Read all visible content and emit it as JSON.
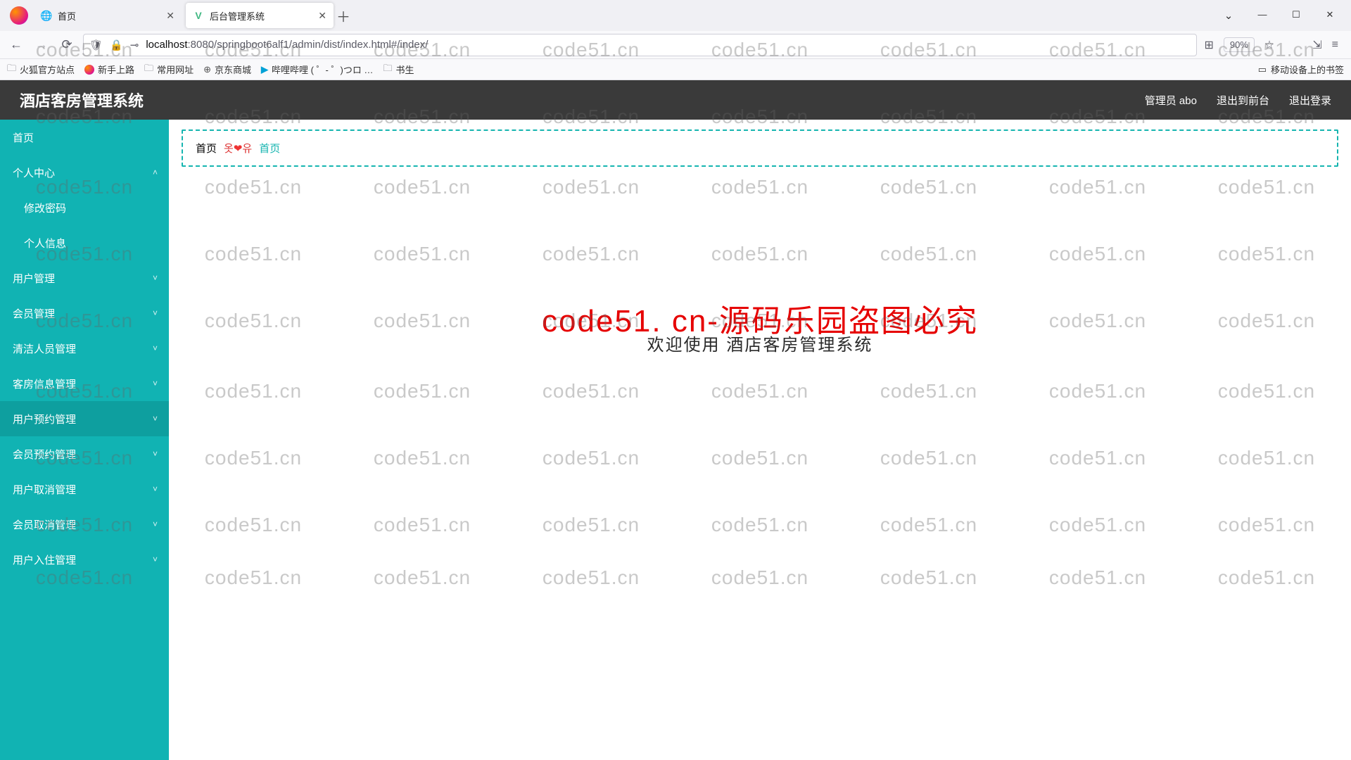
{
  "browser": {
    "tabs": [
      {
        "title": "首页",
        "active": false,
        "favicon": "globe"
      },
      {
        "title": "后台管理系统",
        "active": true,
        "favicon": "vue"
      }
    ],
    "url_host": "localhost",
    "url_rest": ":8080/springboot6alf1/admin/dist/index.html#/index/",
    "zoom": "90%",
    "bookmarks": [
      {
        "label": "火狐官方站点",
        "kind": "folder"
      },
      {
        "label": "新手上路",
        "kind": "firefox"
      },
      {
        "label": "常用网址",
        "kind": "folder"
      },
      {
        "label": "京东商城",
        "kind": "jd"
      },
      {
        "label": "哔哩哔哩 (  ゜- ゜)つロ …",
        "kind": "bili"
      },
      {
        "label": "书生",
        "kind": "folder"
      }
    ],
    "mobile_bookmarks_label": "移动设备上的书签"
  },
  "app": {
    "title": "酒店客房管理系统",
    "header_user": "管理员 abo",
    "header_front": "退出到前台",
    "header_logout": "退出登录",
    "breadcrumb": {
      "first": "首页",
      "emoji": "옷❤유",
      "link": "首页"
    },
    "welcome": "欢迎使用 酒店客房管理系统",
    "big_red": "code51. cn-源码乐园盗图必究",
    "sidebar": [
      {
        "label": "首页",
        "expandable": false
      },
      {
        "label": "个人中心",
        "expandable": true,
        "expanded": true
      },
      {
        "label": "修改密码",
        "sub": true
      },
      {
        "label": "个人信息",
        "sub": true
      },
      {
        "label": "用户管理",
        "expandable": true
      },
      {
        "label": "会员管理",
        "expandable": true
      },
      {
        "label": "清洁人员管理",
        "expandable": true
      },
      {
        "label": "客房信息管理",
        "expandable": true
      },
      {
        "label": "用户预约管理",
        "expandable": true,
        "hover": true
      },
      {
        "label": "会员预约管理",
        "expandable": true
      },
      {
        "label": "用户取消管理",
        "expandable": true
      },
      {
        "label": "会员取消管理",
        "expandable": true
      },
      {
        "label": "用户入住管理",
        "expandable": true
      }
    ]
  },
  "watermark_text": "code51.cn",
  "watermark_rows_y": [
    55,
    150,
    250,
    345,
    440,
    540,
    635,
    730,
    805
  ]
}
